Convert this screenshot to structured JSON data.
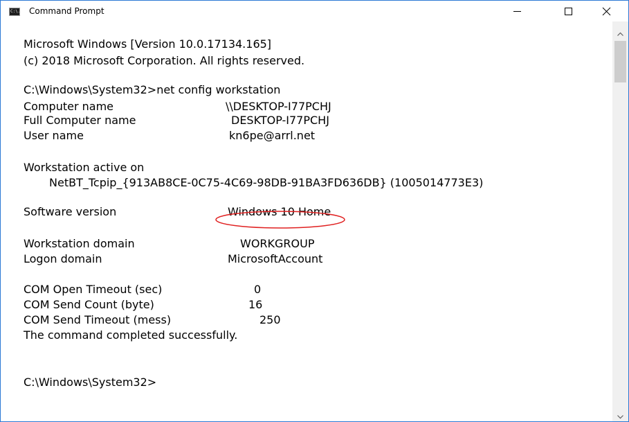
{
  "window": {
    "title": "Command Prompt",
    "icon_name": "cmd-icon",
    "icon_text": "C:\\.",
    "accent_color": "#2b79d4"
  },
  "titlebar_controls": {
    "minimize_icon": "minimize-icon",
    "maximize_icon": "maximize-icon",
    "close_icon": "close-icon"
  },
  "console": {
    "banner_line1": "Microsoft Windows [Version 10.0.17134.165]",
    "banner_line2": "(c) 2018 Microsoft Corporation. All rights reserved.",
    "prompt_command": "C:\\Windows\\System32>net config workstation",
    "rows": [
      {
        "label": "Computer name",
        "value": "\\\\DESKTOP-I77PCHJ"
      },
      {
        "label": "Full Computer name",
        "value": "DESKTOP-I77PCHJ"
      },
      {
        "label": "User name",
        "value": "kn6pe@arrl.net"
      }
    ],
    "active_on_label": "Workstation active on",
    "active_on_value": "NetBT_Tcpip_{913AB8CE-0C75-4C69-98DB-91BA3FD636DB} (1005014773E3)",
    "software_version_label": "Software version",
    "software_version_value": "Windows 10 Home",
    "workstation_domain_label": "Workstation domain",
    "workstation_domain_value": "WORKGROUP",
    "logon_domain_label": "Logon domain",
    "logon_domain_value": "MicrosoftAccount",
    "com_rows": [
      {
        "label": "COM Open Timeout (sec)",
        "value": "0"
      },
      {
        "label": "COM Send Count (byte)",
        "value": "16"
      },
      {
        "label": "COM Send Timeout (mess)",
        "value": "250"
      }
    ],
    "completion_message": "The command completed successfully.",
    "final_prompt": "C:\\Windows\\System32>",
    "highlight_color": "#e02020"
  },
  "scrollbar": {
    "up_icon": "scroll-up-arrow-icon",
    "down_icon": "scroll-down-arrow-icon"
  }
}
